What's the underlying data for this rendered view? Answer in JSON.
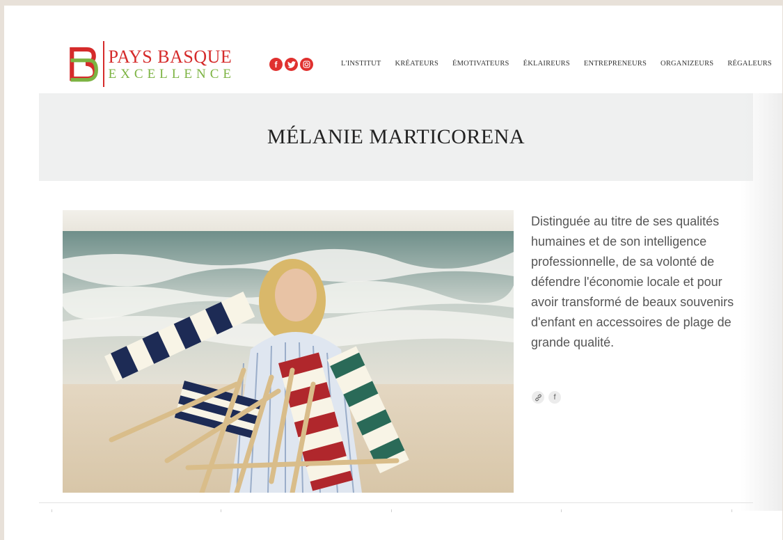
{
  "brand": {
    "line1": "PAYS BASQUE",
    "line2": "EXCELLENCE",
    "red": "#d52b2b",
    "green": "#7cb342"
  },
  "social": [
    {
      "icon": "facebook-icon",
      "glyph": "f"
    },
    {
      "icon": "twitter-icon",
      "glyph": "t"
    },
    {
      "icon": "instagram-icon",
      "glyph": "◎"
    }
  ],
  "nav": {
    "items": [
      "L'INSTITUT",
      "KRÉATEURS",
      "ÉMOTIVATEURS",
      "ÉKLAIREURS",
      "ENTREPRENEURS",
      "ORGANIZEURS",
      "RÉGALEURS"
    ]
  },
  "page": {
    "title": "MÉLANIE MARTICORENA"
  },
  "bio": {
    "text": "Distinguée au titre de ses qualités humaines et de son intelligence professionnelle, de sa volonté de défendre l'économie locale et pour avoir transformé de beaux souvenirs d'enfant en accessoires de plage de grande qualité."
  },
  "share": [
    {
      "icon": "link-icon",
      "glyph": "🔗"
    },
    {
      "icon": "facebook-icon",
      "glyph": "f"
    }
  ]
}
